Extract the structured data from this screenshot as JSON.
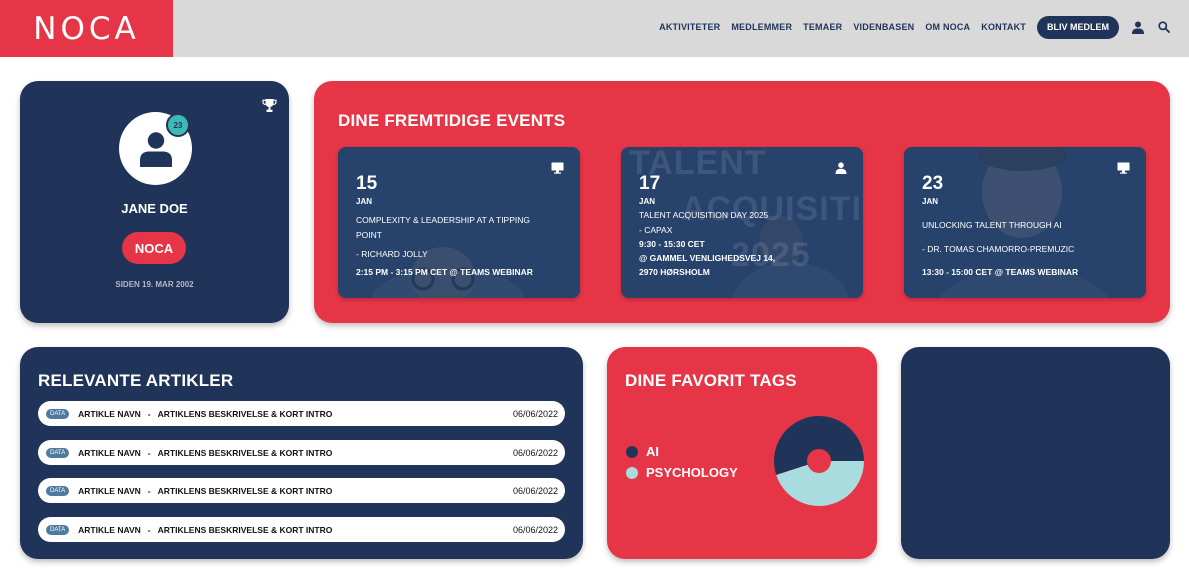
{
  "header": {
    "logo": "NOCA",
    "nav": [
      "AKTIVITETER",
      "MEDLEMMER",
      "TEMAER",
      "VIDENBASEN",
      "OM NOCA",
      "KONTAKT"
    ],
    "join_label": "BLIV MEDLEM",
    "icons": [
      "user-icon",
      "search-icon"
    ]
  },
  "profile": {
    "badge_count": "23",
    "name": "JANE DOE",
    "org_button": "NOCA",
    "member_since": "SIDEN 19. MAR 2002",
    "icons": [
      "trophy-icon",
      "user-avatar-icon"
    ]
  },
  "events": {
    "title": "DINE FREMTIDIGE EVENTS",
    "items": [
      {
        "day": "15",
        "month": "JAN",
        "icon": "monitor-icon",
        "lines": [
          "COMPLEXITY &  LEADERSHIP AT A TIPPING",
          "POINT",
          "- RICHARD JOLLY",
          "2:15 PM - 3:15 PM CET @ TEAMS WEBINAR"
        ]
      },
      {
        "day": "17",
        "month": "JAN",
        "icon": "person-icon",
        "lines": [
          "TALENT ACQUISITION DAY 2025",
          "- CAPAX",
          "9:30 - 15:30 CET",
          "@ GAMMEL VENLIGHEDSVEJ 14,",
          "2970 HØRSHOLM"
        ]
      },
      {
        "day": "23",
        "month": "JAN",
        "icon": "monitor-icon",
        "lines": [
          "UNLOCKING TALENT THROUGH AI",
          "- DR. TOMAS CHAMORRO-PREMUZIC",
          "13:30 - 15:00 CET @ TEAMS WEBINAR"
        ]
      }
    ]
  },
  "articles": {
    "title": "RELEVANTE ARTIKLER",
    "rows": [
      {
        "tag": "DATA",
        "name": "ARTIKLE NAVN",
        "sep": "-",
        "desc": "ARTIKLENS BESKRIVELSE & KORT INTRO",
        "date": "06/06/2022"
      },
      {
        "tag": "DATA",
        "name": "ARTIKLE NAVN",
        "sep": "-",
        "desc": "ARTIKLENS BESKRIVELSE & KORT INTRO",
        "date": "06/06/2022"
      },
      {
        "tag": "DATA",
        "name": "ARTIKLE NAVN",
        "sep": "-",
        "desc": "ARTIKLENS BESKRIVELSE & KORT INTRO",
        "date": "06/06/2022"
      },
      {
        "tag": "DATA",
        "name": "ARTIKLE NAVN",
        "sep": "-",
        "desc": "ARTIKLENS BESKRIVELSE & KORT INTRO",
        "date": "06/06/2022"
      }
    ]
  },
  "tags": {
    "title": "DINE FAVORIT TAGS",
    "items": [
      {
        "label": "AI",
        "color": "#1f3458",
        "share": 0.55
      },
      {
        "label": "PSYCHOLOGY",
        "color": "#a8dcdf",
        "share": 0.45
      }
    ]
  },
  "colors": {
    "navy": "#1f3458",
    "red": "#e63546",
    "teal": "#3cb8b5",
    "light_teal": "#a8dcdf"
  }
}
